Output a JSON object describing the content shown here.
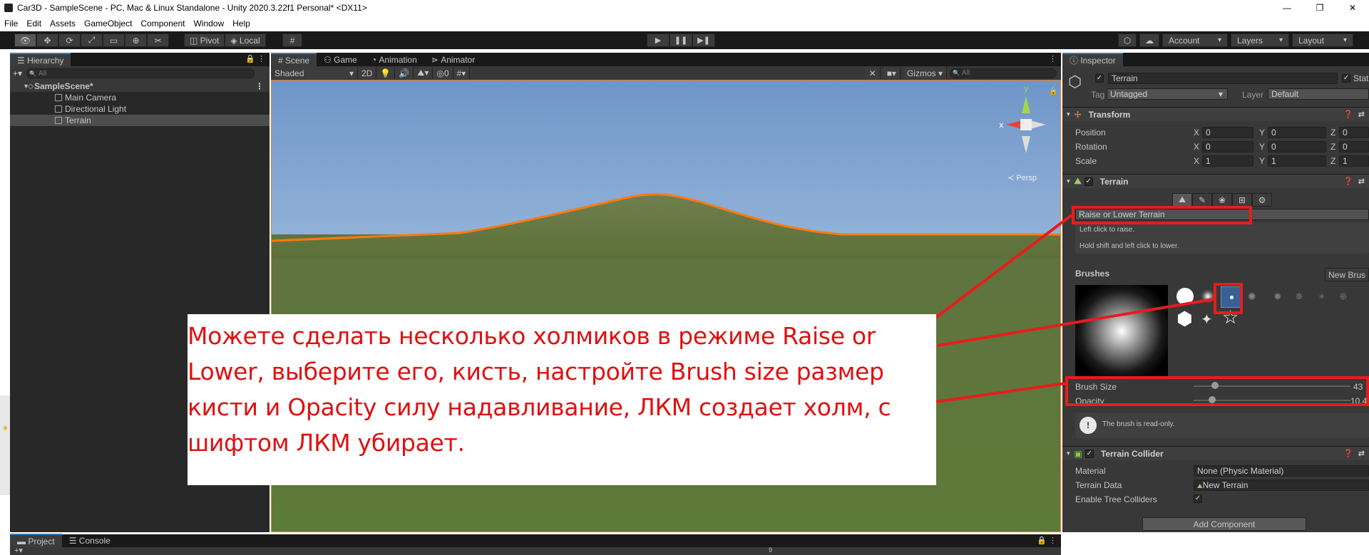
{
  "window": {
    "title": "Car3D - SampleScene - PC, Mac & Linux Standalone - Unity 2020.3.22f1 Personal* <DX11>",
    "controls": [
      "—",
      "❐",
      "✕"
    ]
  },
  "menu": [
    "File",
    "Edit",
    "Assets",
    "GameObject",
    "Component",
    "Window",
    "Help"
  ],
  "toolbar": {
    "tools": [
      "view-tool-icon",
      "move-tool-icon",
      "rotate-tool-icon",
      "scale-tool-icon",
      "rect-tool-icon",
      "transform-tool-icon",
      "custom-tool-icon"
    ],
    "pivot": "Pivot",
    "local": "Local",
    "play": "▶",
    "pause": "❚❚",
    "step": "▶❚",
    "account": "Account",
    "layers": "Layers",
    "layout": "Layout"
  },
  "hierarchy": {
    "tab": "Hierarchy",
    "add": "+▾",
    "search_placeholder": "All",
    "scene": "SampleScene*",
    "items": [
      "Main Camera",
      "Directional Light",
      "Terrain"
    ]
  },
  "scene": {
    "tabs": [
      "Scene",
      "Game",
      "Animation",
      "Animator"
    ],
    "shading": "Shaded",
    "mode2d": "2D",
    "fx_count": "0",
    "gizmos": "Gizmos",
    "search_placeholder": "All",
    "gizmo_axes": {
      "x": "x",
      "y": "y"
    },
    "persp": "≺ Persp"
  },
  "inspector": {
    "tab": "Inspector",
    "object_name": "Terrain",
    "static": "Stat",
    "tag_label": "Tag",
    "tag_value": "Untagged",
    "layer_label": "Layer",
    "layer_value": "Default",
    "transform": {
      "title": "Transform",
      "rows": [
        {
          "label": "Position",
          "x": "0",
          "y": "0",
          "z": "0"
        },
        {
          "label": "Rotation",
          "x": "0",
          "y": "0",
          "z": "0"
        },
        {
          "label": "Scale",
          "x": "1",
          "y": "1",
          "z": "1"
        }
      ]
    },
    "terrain": {
      "title": "Terrain",
      "mode": "Raise or Lower Terrain",
      "help1": "Left click to raise.",
      "help2": "Hold shift and left click to lower.",
      "brushes_label": "Brushes",
      "new_brush": "New Brus",
      "brush_size_label": "Brush Size",
      "brush_size_value": "43",
      "brush_size_level": 0.12,
      "opacity_label": "Opacity",
      "opacity_value": "10.4",
      "opacity_level": 0.1,
      "readonly_msg": "The brush is read-only."
    },
    "collider": {
      "title": "Terrain Collider",
      "material_label": "Material",
      "material_value": "None (Physic Material)",
      "data_label": "Terrain Data",
      "data_value": "New Terrain",
      "trees_label": "Enable Tree Colliders"
    },
    "add_component": "Add Component"
  },
  "bottom": {
    "tabs": [
      "Project",
      "Console"
    ],
    "count": "9"
  },
  "annotation": {
    "text": "Можете сделать несколько холмиков в режиме Raise or Lower, выберите его, кисть, настройте Brush size размер кисти и Opacity силу надавливание, ЛКМ создает холм, с шифтом ЛКМ убирает."
  },
  "colors": {
    "highlight": "#e81c1c",
    "selection": "#ff7a10",
    "accent": "#3a79bb"
  }
}
